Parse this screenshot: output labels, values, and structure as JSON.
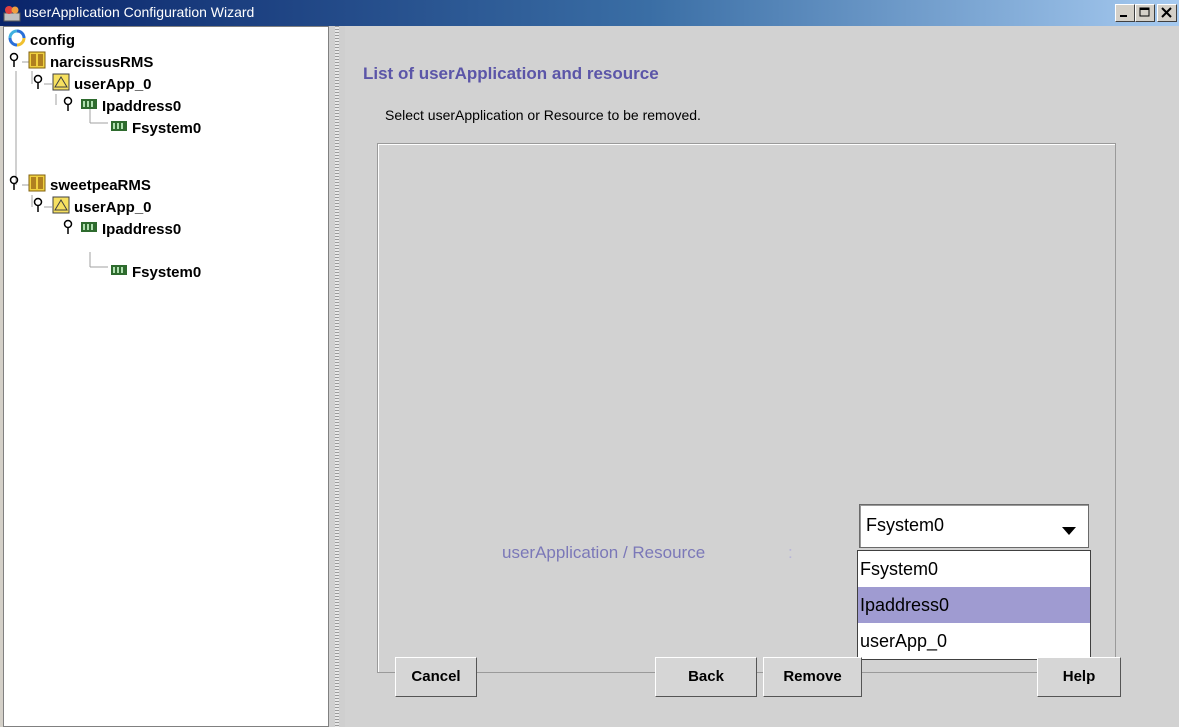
{
  "window": {
    "title": "userApplication Configuration Wizard"
  },
  "tree": {
    "root": "config",
    "nodes": [
      {
        "label": "narcissusRMS",
        "type": "cluster-node"
      },
      {
        "label": "userApp_0",
        "type": "user-application"
      },
      {
        "label": "Ipaddress0",
        "type": "resource"
      },
      {
        "label": "Fsystem0",
        "type": "resource"
      },
      {
        "label": "sweetpeaRMS",
        "type": "cluster-node"
      },
      {
        "label": "userApp_0",
        "type": "user-application"
      },
      {
        "label": "Ipaddress0",
        "type": "resource"
      },
      {
        "label": "Fsystem0",
        "type": "resource"
      }
    ]
  },
  "main": {
    "heading": "List of userApplication and resource",
    "instruction": "Select userApplication or Resource to be removed.",
    "field_label": "userApplication / Resource",
    "field_colon": ":",
    "combo_value": "Fsystem0",
    "dropdown_options": [
      "Fsystem0",
      "Ipaddress0",
      "userApp_0"
    ],
    "dropdown_highlighted": "Ipaddress0"
  },
  "buttons": {
    "cancel": "Cancel",
    "back": "Back",
    "remove": "Remove",
    "help": "Help"
  },
  "colors": {
    "heading": "#5b55a8",
    "field_label": "#7b78b8",
    "selection": "#9f9bd1",
    "titlebar": "#0a246a"
  }
}
